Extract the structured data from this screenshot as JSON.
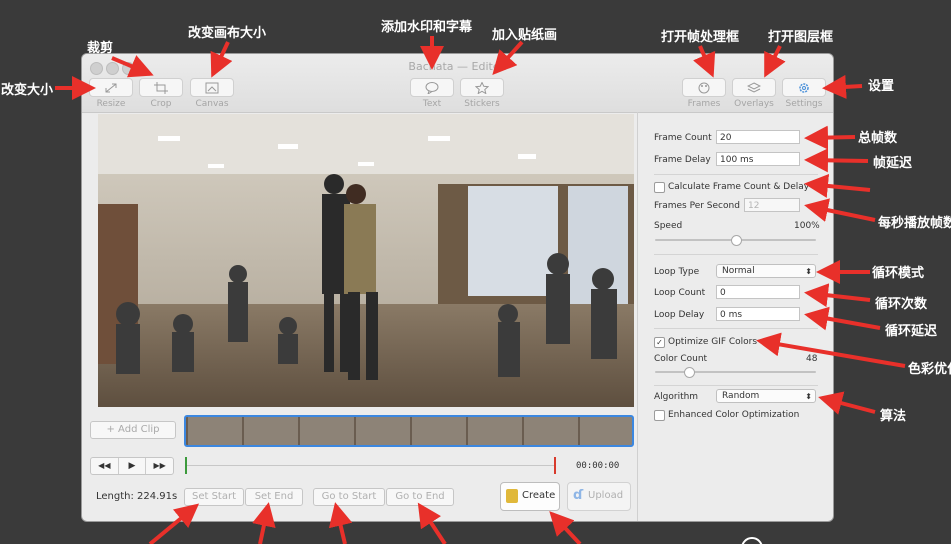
{
  "window": {
    "title": "Bachata — Edited"
  },
  "toolbar": {
    "resize": "Resize",
    "crop": "Crop",
    "canvas": "Canvas",
    "text": "Text",
    "stickers": "Stickers",
    "frames": "Frames",
    "overlays": "Overlays",
    "settings": "Settings"
  },
  "annotations": {
    "resize": "改变大小",
    "crop": "裁剪",
    "canvas": "改变画布大小",
    "text": "添加水印和字幕",
    "stickers": "加入贴纸画",
    "frames": "打开帧处理框",
    "overlays": "打开图层框",
    "settings": "设置",
    "frame_count": "总帧数",
    "frame_delay": "帧延迟",
    "fps": "每秒播放帧数",
    "loop_type": "循环模式",
    "loop_count": "循环次数",
    "loop_delay": "循环延迟",
    "optimize": "色彩优化",
    "algorithm": "算法"
  },
  "settings": {
    "frame_count_label": "Frame Count",
    "frame_count": "20",
    "frame_delay_label": "Frame Delay",
    "frame_delay": "100 ms",
    "calc_label": "Calculate Frame Count & Delay",
    "fps_label": "Frames Per Second",
    "fps": "12",
    "speed_label": "Speed",
    "speed": "100%",
    "speed_value": 0.5,
    "loop_type_label": "Loop Type",
    "loop_type": "Normal",
    "loop_count_label": "Loop Count",
    "loop_count": "0",
    "loop_delay_label": "Loop Delay",
    "loop_delay": "0 ms",
    "optimize_label": "Optimize GIF Colors",
    "optimize_check": "✓",
    "color_count_label": "Color Count",
    "color_count": "48",
    "color_count_value": 0.19,
    "algorithm_label": "Algorithm",
    "algorithm": "Random",
    "enhanced_label": "Enhanced Color Optimization"
  },
  "timeline": {
    "add_clip": "+ Add Clip",
    "time": "00:00:00"
  },
  "bottom": {
    "length": "Length: 224.91s",
    "set_start": "Set Start",
    "set_end": "Set End",
    "go_start": "Go to Start",
    "go_end": "Go to End",
    "create": "Create",
    "upload": "Upload"
  }
}
